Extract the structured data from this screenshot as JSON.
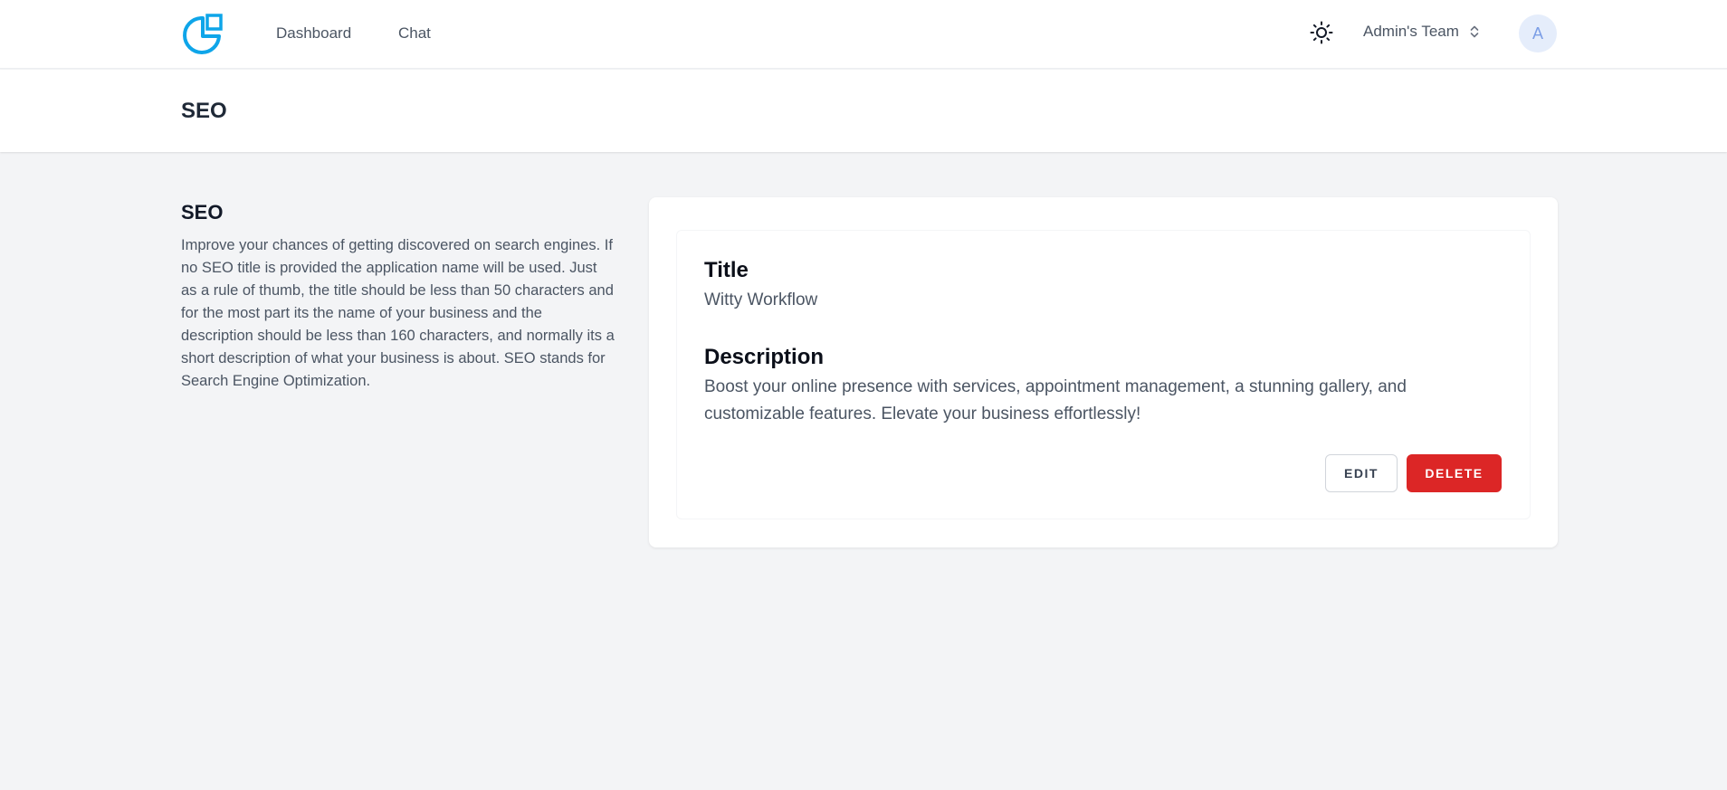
{
  "nav": {
    "links": [
      {
        "label": "Dashboard"
      },
      {
        "label": "Chat"
      }
    ],
    "team": "Admin's Team",
    "avatar_initial": "A",
    "brand_color": "#0ea5e9"
  },
  "header": {
    "title": "SEO"
  },
  "section": {
    "title": "SEO",
    "description": "Improve your chances of getting discovered on search engines. If no SEO title is provided the application name will be used. Just as a rule of thumb, the title should be less than 50 characters and for the most part its the name of your business and the description should be less than 160 characters, and normally its a short description of what your business is about. SEO stands for Search Engine Optimization."
  },
  "card": {
    "title_label": "Title",
    "title_value": "Witty Workflow",
    "description_label": "Description",
    "description_value": "Boost your online presence with services, appointment management, a stunning gallery, and customizable features. Elevate your business effortlessly!",
    "edit_label": "EDIT",
    "delete_label": "DELETE",
    "delete_color": "#dc2626"
  },
  "icons": {
    "logo": "logo-icon",
    "theme": "sun-icon",
    "team_switch": "chevron-up-down-icon"
  }
}
